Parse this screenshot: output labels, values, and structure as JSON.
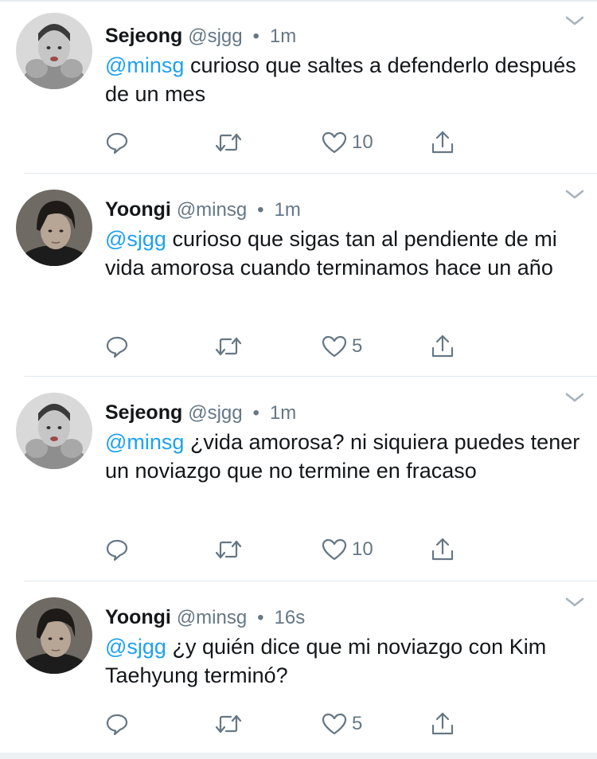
{
  "tweets": [
    {
      "name": "Sejeong",
      "handle": "@sjgg",
      "separator": "•",
      "time": "1m",
      "mention": "@minsg",
      "text": " curioso que saltes a defenderlo después de un mes",
      "likes": "10",
      "avatar": "sejeong"
    },
    {
      "name": "Yoongi",
      "handle": "@minsg",
      "separator": "•",
      "time": "1m",
      "mention": "@sjgg",
      "text": " curioso que sigas tan al pendiente de mi vida amorosa cuando terminamos hace un año",
      "likes": "5",
      "avatar": "yoongi"
    },
    {
      "name": "Sejeong",
      "handle": "@sjgg",
      "separator": "•",
      "time": "1m",
      "mention": "@minsg",
      "text": " ¿vida amorosa? ni siquiera puedes tener un noviazgo que no termine en fracaso",
      "likes": "10",
      "avatar": "sejeong"
    },
    {
      "name": "Yoongi",
      "handle": "@minsg",
      "separator": "•",
      "time": "16s",
      "mention": "@sjgg",
      "text": " ¿y quién dice que mi noviazgo con Kim Taehyung terminó?",
      "likes": "5",
      "avatar": "yoongi"
    }
  ],
  "icons": {
    "reply": "reply-icon",
    "retweet": "retweet-icon",
    "like": "heart-icon",
    "share": "share-icon",
    "more": "chevron-down-icon"
  },
  "colors": {
    "text": "#14171a",
    "secondary": "#657786",
    "accent": "#1da1f2",
    "divider": "#e1e8ed"
  }
}
